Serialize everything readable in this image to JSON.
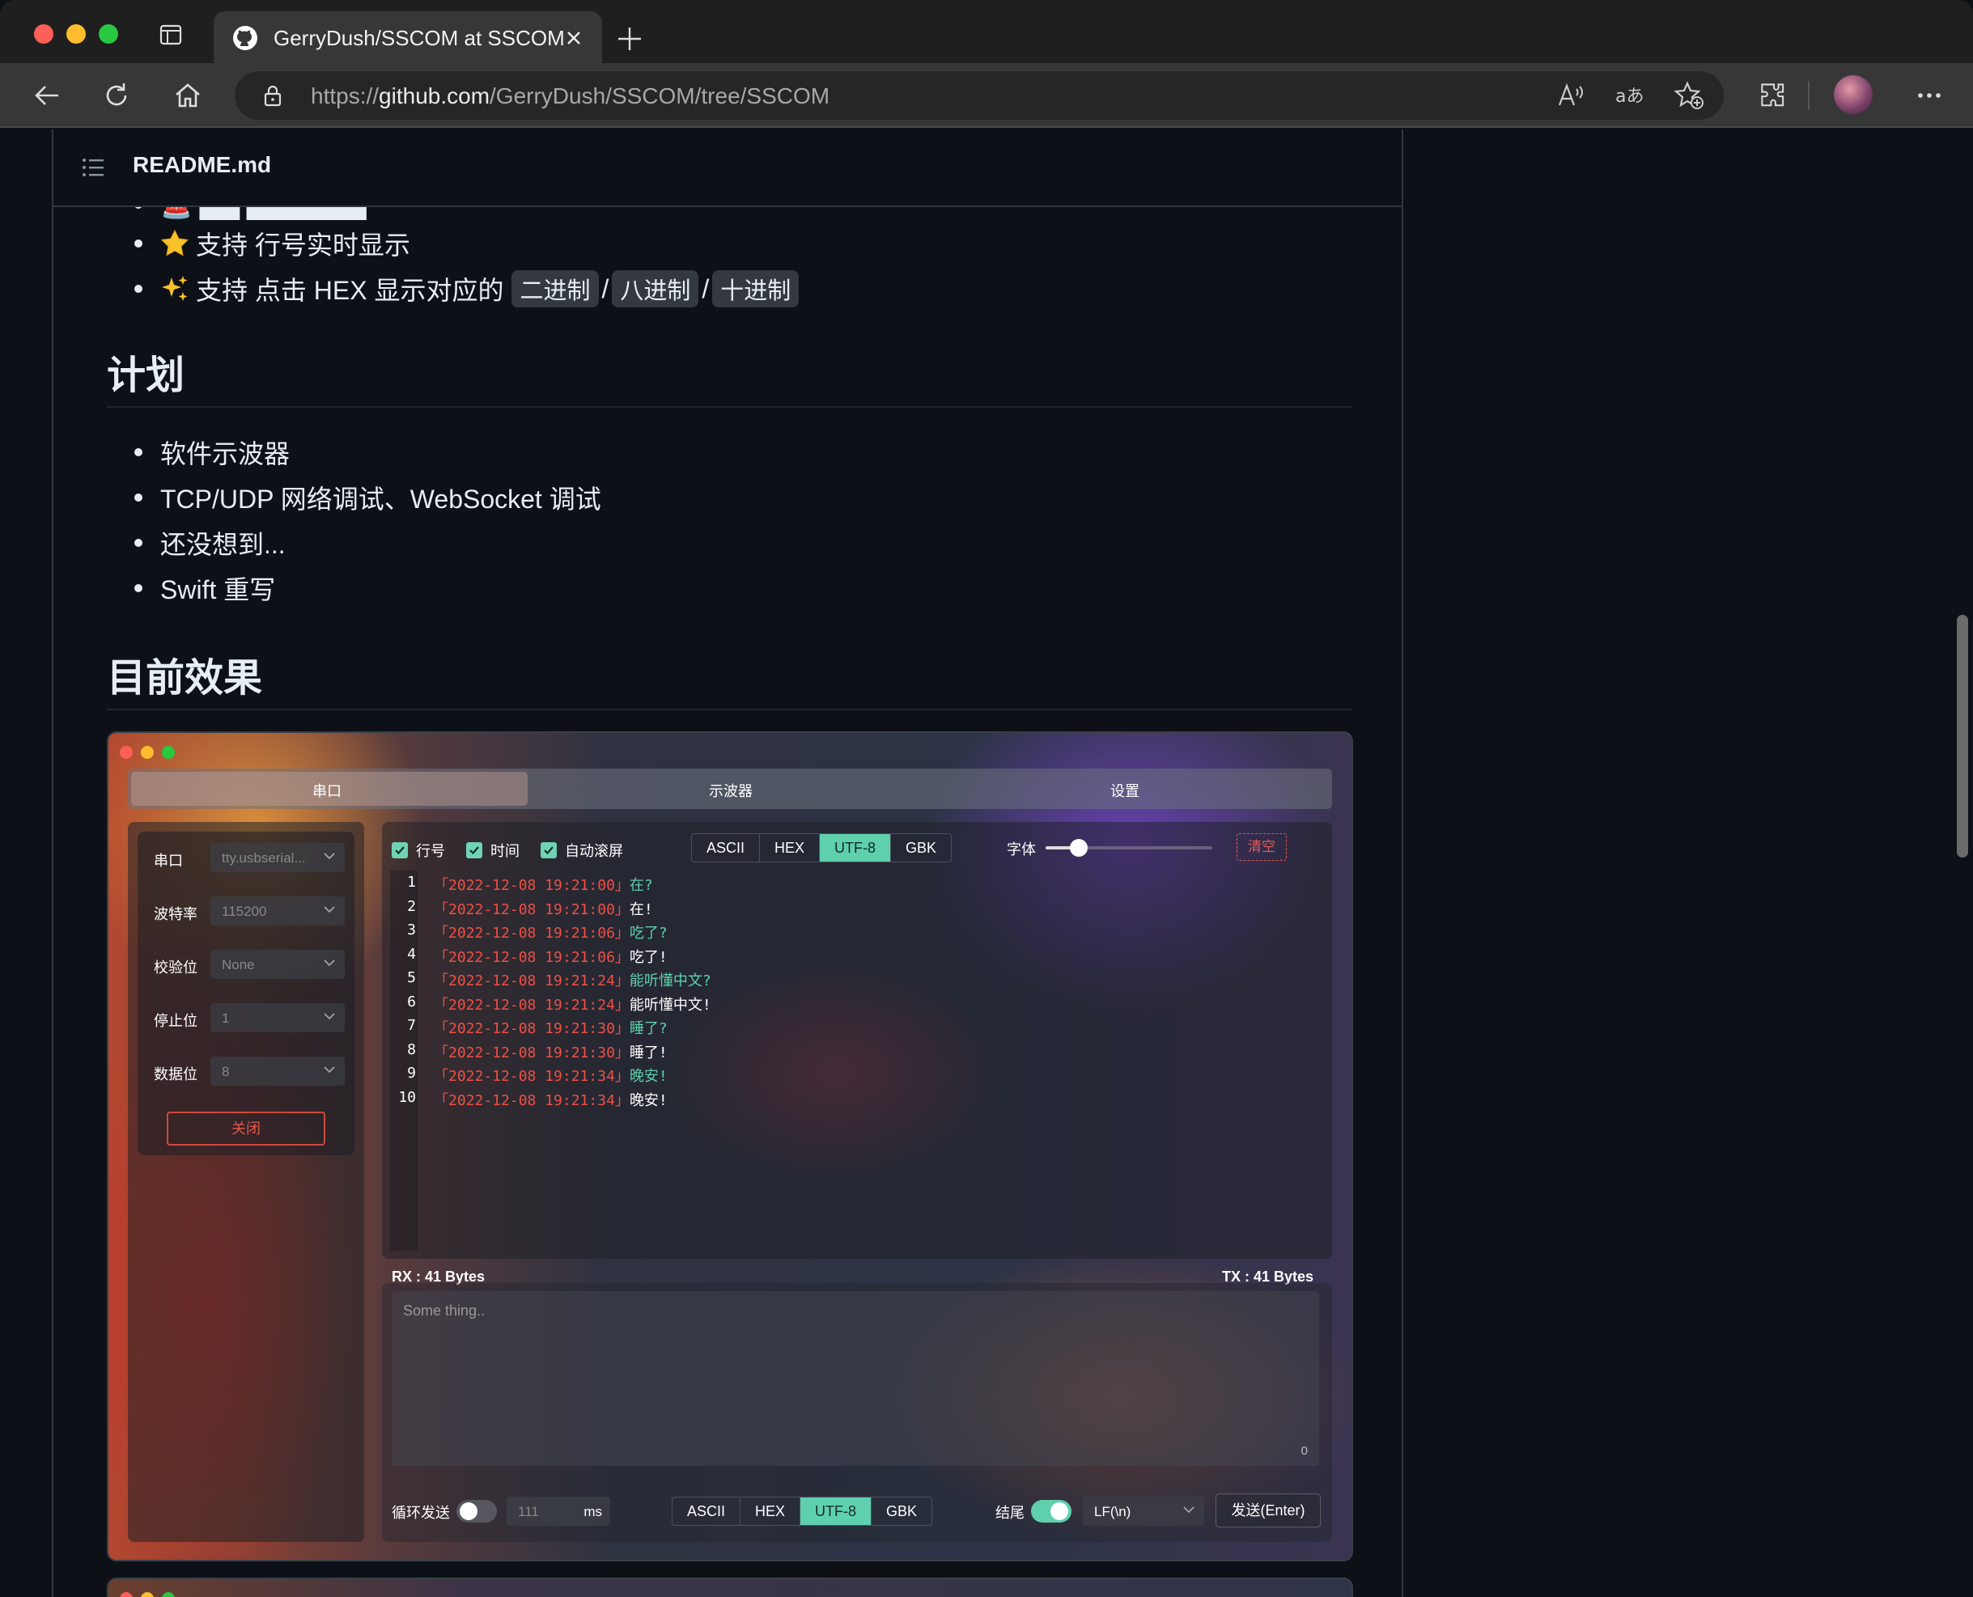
{
  "browser": {
    "tab_title": "GerryDush/SSCOM at SSCOM",
    "url_prefix": "https://",
    "url_domain": "github.com",
    "url_path": "/GerryDush/SSCOM/tree/SSCOM"
  },
  "readme": {
    "filename": "README.md",
    "features": {
      "line_numbers": "支持 行号实时显示",
      "hex_prefix": "支持 点击 HEX 显示对应的",
      "binary": "二进制",
      "octal": "八进制",
      "decimal": "十进制",
      "slash": "/"
    },
    "plan_heading": "计划",
    "plan_items": [
      "软件示波器",
      "TCP/UDP 网络调试、WebSocket 调试",
      "还没想到...",
      "Swift 重写"
    ],
    "effect_heading": "目前效果"
  },
  "app": {
    "tabs": [
      "串口",
      "示波器",
      "设置"
    ],
    "fields": [
      {
        "label": "串口",
        "value": "tty.usbserial..."
      },
      {
        "label": "波特率",
        "value": "115200"
      },
      {
        "label": "校验位",
        "value": "None"
      },
      {
        "label": "停止位",
        "value": "1"
      },
      {
        "label": "数据位",
        "value": "8"
      }
    ],
    "close_label": "关闭",
    "checkboxes": [
      "行号",
      "时间",
      "自动滚屏"
    ],
    "encodings": [
      "ASCII",
      "HEX",
      "UTF-8",
      "GBK"
    ],
    "active_encoding": "UTF-8",
    "font_label": "字体",
    "font_slider_level": 0.2,
    "clear_label": "清空",
    "log": [
      {
        "n": "1",
        "ts": "「2022-12-08 19:21:00」",
        "msg": "在?",
        "color": "green"
      },
      {
        "n": "2",
        "ts": "「2022-12-08 19:21:00」",
        "msg": "在!",
        "color": "white"
      },
      {
        "n": "3",
        "ts": "「2022-12-08 19:21:06」",
        "msg": "吃了?",
        "color": "green"
      },
      {
        "n": "4",
        "ts": "「2022-12-08 19:21:06」",
        "msg": "吃了!",
        "color": "white"
      },
      {
        "n": "5",
        "ts": "「2022-12-08 19:21:24」",
        "msg": "能听懂中文?",
        "color": "green"
      },
      {
        "n": "6",
        "ts": "「2022-12-08 19:21:24」",
        "msg": "能听懂中文!",
        "color": "white"
      },
      {
        "n": "7",
        "ts": "「2022-12-08 19:21:30」",
        "msg": "睡了?",
        "color": "green"
      },
      {
        "n": "8",
        "ts": "「2022-12-08 19:21:30」",
        "msg": "睡了!",
        "color": "white"
      },
      {
        "n": "9",
        "ts": "「2022-12-08 19:21:34」",
        "msg": "晚安!",
        "color": "green"
      },
      {
        "n": "10",
        "ts": "「2022-12-08 19:21:34」",
        "msg": "晚安!",
        "color": "white"
      }
    ],
    "rx": "RX : 41 Bytes",
    "tx": "TX : 41 Bytes",
    "input_placeholder": "Some thing..",
    "char_count": "0",
    "loop_label": "循环发送",
    "interval_value": "111",
    "interval_unit": "ms",
    "ending_label": "结尾",
    "ending_value": "LF(\\n)",
    "send_label": "发送(Enter)"
  },
  "colors": {
    "accent_green": "#5fd0ae",
    "timestamp_red": "#ef4f45",
    "github_bg": "#0d1117"
  }
}
